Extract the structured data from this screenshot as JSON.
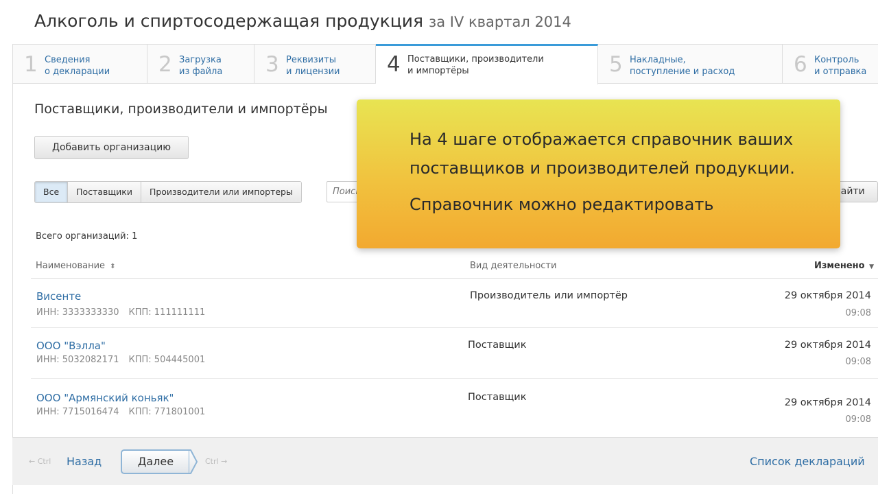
{
  "header": {
    "title": "Алкоголь и спиртосодержащая продукция",
    "period": "за IV квартал 2014"
  },
  "steps": [
    {
      "num": "1",
      "line1": "Сведения",
      "line2": "о декларации"
    },
    {
      "num": "2",
      "line1": "Загрузка",
      "line2": "из файла"
    },
    {
      "num": "3",
      "line1": "Реквизиты",
      "line2": "и лицензии"
    },
    {
      "num": "4",
      "line1": "Поставщики, производители",
      "line2": "и импортёры"
    },
    {
      "num": "5",
      "line1": "Накладные,",
      "line2": "поступление и расход"
    },
    {
      "num": "6",
      "line1": "Контроль",
      "line2": "и отправка"
    }
  ],
  "section": {
    "title": "Поставщики, производители и импортёры",
    "add_button": "Добавить организацию"
  },
  "filters": [
    "Все",
    "Поставщики",
    "Производители или импортеры"
  ],
  "search": {
    "placeholder": "Поиск",
    "button": "Найти"
  },
  "count_label": "Всего организаций: 1",
  "table": {
    "headers": {
      "name": "Наименование",
      "activity": "Вид деятельности",
      "changed": "Изменено"
    },
    "rows": [
      {
        "name": "Висенте",
        "inn": "ИНН: 3333333330",
        "kpp": "КПП: 111111111",
        "activity": "Производитель или импортёр",
        "date": "29 октября 2014",
        "time": "09:08"
      },
      {
        "name": "ООО \"Вэлла\"",
        "inn": "ИНН: 5032082171",
        "kpp": "КПП: 504445001",
        "activity": "Поставщик",
        "date": "29 октября 2014",
        "time": "09:08"
      },
      {
        "name": "ООО \"Армянский коньяк\"",
        "inn": "ИНН: 7715016474",
        "kpp": "КПП: 771801001",
        "activity": "Поставщик",
        "date": "29 октября 2014",
        "time": "09:08"
      }
    ]
  },
  "footer": {
    "back_hint": "← Ctrl",
    "back": "Назад",
    "next": "Далее",
    "next_hint": "Ctrl →",
    "declarations": "Список деклараций"
  },
  "callout": {
    "line1": "На 4 шаге отображается справочник ваших",
    "line2": "поставщиков и производителей продукции.",
    "line3": "Справочник можно редактировать"
  }
}
